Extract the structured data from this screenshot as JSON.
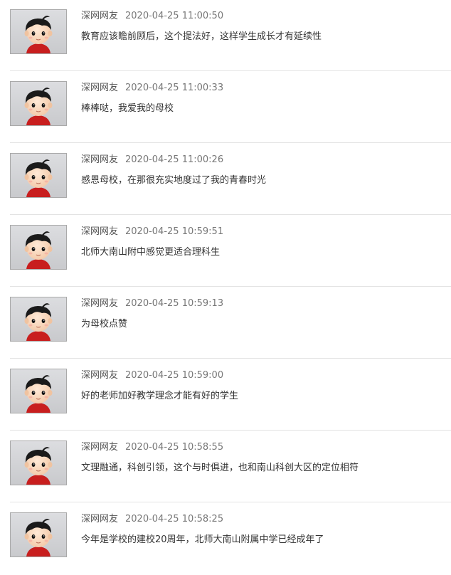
{
  "comments": [
    {
      "author": "深网网友",
      "time": "2020-04-25 11:00:50",
      "text": "教育应该瞻前顾后，这个提法好，这样学生成长才有延续性"
    },
    {
      "author": "深网网友",
      "time": "2020-04-25 11:00:33",
      "text": "棒棒哒，我爱我的母校"
    },
    {
      "author": "深网网友",
      "time": "2020-04-25 11:00:26",
      "text": "感恩母校，在那很充实地度过了我的青春时光"
    },
    {
      "author": "深网网友",
      "time": "2020-04-25 10:59:51",
      "text": "北师大南山附中感觉更适合理科生"
    },
    {
      "author": "深网网友",
      "time": "2020-04-25 10:59:13",
      "text": "为母校点赞"
    },
    {
      "author": "深网网友",
      "time": "2020-04-25 10:59:00",
      "text": "好的老师加好教学理念才能有好的学生"
    },
    {
      "author": "深网网友",
      "time": "2020-04-25 10:58:55",
      "text": "文理融通，科创引领，这个与时俱进，也和南山科创大区的定位相符"
    },
    {
      "author": "深网网友",
      "time": "2020-04-25 10:58:25",
      "text": "今年是学校的建校20周年，北师大南山附属中学已经成年了"
    }
  ],
  "avatar_icon": "cartoon-boy-avatar-icon",
  "colors": {
    "divider": "#e3e3e3",
    "avatar_border": "#a9a9a9",
    "shirt": "#c81e1e"
  }
}
